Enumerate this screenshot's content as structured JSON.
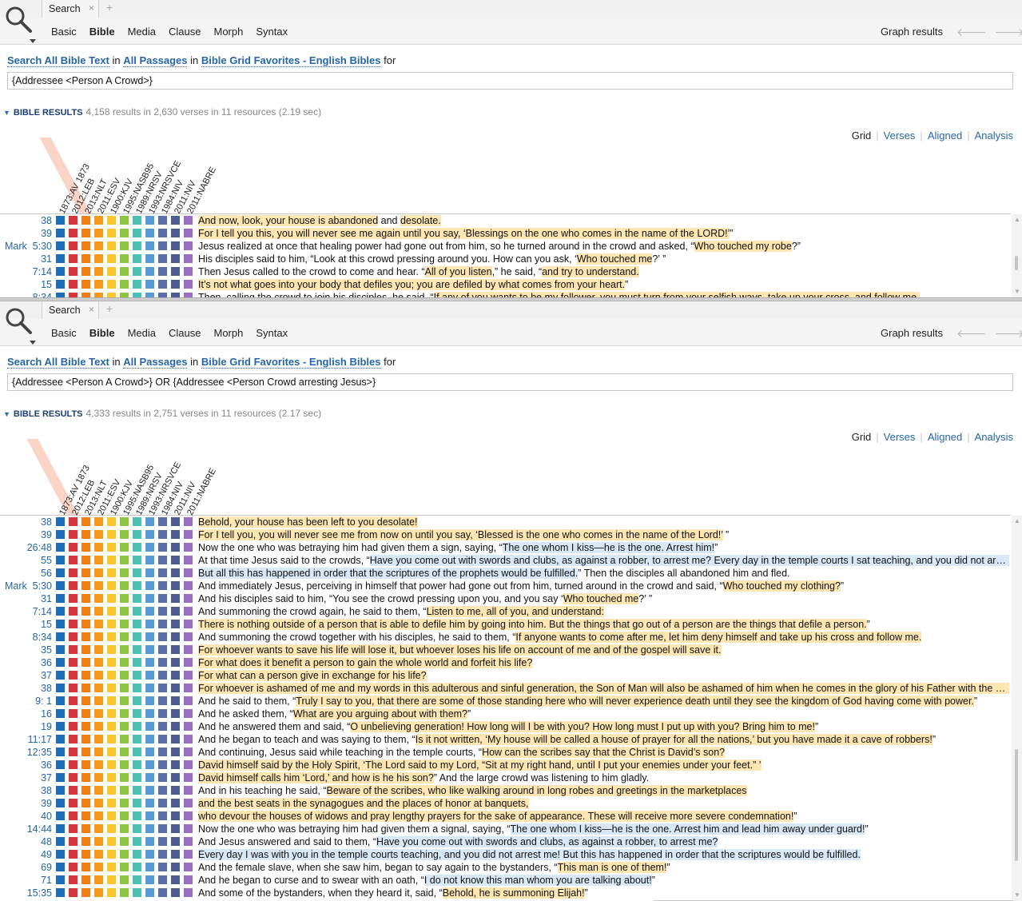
{
  "colors": {
    "squares": [
      "#1f6fb8",
      "#d6353a",
      "#ef7d1a",
      "#f49a1e",
      "#f7c92f",
      "#8cc63e",
      "#4ec1b7",
      "#5a9ad9",
      "#5a6fa8",
      "#4b5e8f",
      "#9b6fc0"
    ]
  },
  "panels": [
    {
      "tab": {
        "label": "Search",
        "close": "×",
        "add": "+"
      },
      "nav": {
        "basic": "Basic",
        "bible": "Bible",
        "media": "Media",
        "clause": "Clause",
        "morph": "Morph",
        "syntax": "Syntax"
      },
      "graph_results": "Graph results",
      "scope": {
        "search_all": "Search All Bible Text",
        "in1": "in",
        "passages": "All Passages",
        "in2": "in",
        "collection": "Bible Grid Favorites - English Bibles",
        "for": "for"
      },
      "query": "{Addressee  <Person A Crowd>}",
      "results_header": {
        "title": "BIBLE RESULTS",
        "stats": "4,158 results in 2,630 verses in 11 resources (2.19 sec)"
      },
      "views": {
        "grid": "Grid",
        "verses": "Verses",
        "aligned": "Aligned",
        "analysis": "Analysis"
      },
      "columns": [
        "1873:AV 1873",
        "2012:LEB",
        "2013:NLT",
        "2011:ESV",
        "1900:KJV",
        "1995:NASB95",
        "1989:NRSV",
        "1993:NRSVCE",
        "1984:NIV",
        "2011:NIV",
        "2011:NABRE"
      ],
      "highlight_col": 2,
      "rows": [
        {
          "book": "",
          "ref": "38",
          "parts": [
            {
              "t": "And now, look, your house is abandoned",
              "h": "y"
            },
            {
              "t": " and ",
              "h": ""
            },
            {
              "t": "desolate.",
              "h": "y"
            }
          ]
        },
        {
          "book": "",
          "ref": "39",
          "parts": [
            {
              "t": "For I tell you this, you will never see me again until you say, ‘Blessings on the one who comes in the name of the LORD!’",
              "h": "y"
            },
            {
              "t": "”",
              "h": ""
            }
          ]
        },
        {
          "book": "Mark",
          "ref": "5:30",
          "parts": [
            {
              "t": "Jesus realized at once that healing power had gone out from him, so he turned around in the crowd and asked, “",
              "h": ""
            },
            {
              "t": "Who touched my robe",
              "h": "y"
            },
            {
              "t": "?”",
              "h": ""
            }
          ]
        },
        {
          "book": "",
          "ref": "31",
          "parts": [
            {
              "t": "His disciples said to him, “Look at this crowd pressing around you. How can you ask, ‘",
              "h": ""
            },
            {
              "t": "Who touched me",
              "h": "y"
            },
            {
              "t": "?’ ”",
              "h": ""
            }
          ]
        },
        {
          "book": "",
          "ref": "7:14",
          "parts": [
            {
              "t": "Then Jesus called to the crowd to come and hear. “",
              "h": ""
            },
            {
              "t": "All of you listen",
              "h": "y"
            },
            {
              "t": ",” he said, “",
              "h": ""
            },
            {
              "t": "and try to understand.",
              "h": "y"
            }
          ]
        },
        {
          "book": "",
          "ref": "15",
          "parts": [
            {
              "t": "It’s not what goes into your body that defiles you; you are defiled by what comes from your heart.",
              "h": "y"
            },
            {
              "t": "”",
              "h": ""
            }
          ]
        },
        {
          "book": "",
          "ref": "8:34",
          "parts": [
            {
              "t": "Then, calling the crowd to join his disciples, he said, “",
              "h": ""
            },
            {
              "t": "If any of you wants to be my follower, you must turn from your selfish ways, take up your cross, and follow me.",
              "h": "y"
            }
          ]
        }
      ]
    },
    {
      "tab": {
        "label": "Search",
        "close": "×",
        "add": "+"
      },
      "nav": {
        "basic": "Basic",
        "bible": "Bible",
        "media": "Media",
        "clause": "Clause",
        "morph": "Morph",
        "syntax": "Syntax"
      },
      "graph_results": "Graph results",
      "scope": {
        "search_all": "Search All Bible Text",
        "in1": "in",
        "passages": "All Passages",
        "in2": "in",
        "collection": "Bible Grid Favorites - English Bibles",
        "for": "for"
      },
      "query": "{Addressee  <Person A Crowd>} OR {Addressee  <Person Crowd arresting Jesus>}",
      "results_header": {
        "title": "BIBLE RESULTS",
        "stats": "4,333 results in 2,751 verses in 11 resources (2.17 sec)"
      },
      "views": {
        "grid": "Grid",
        "verses": "Verses",
        "aligned": "Aligned",
        "analysis": "Analysis"
      },
      "columns": [
        "1873:AV 1873",
        "2012:LEB",
        "2013:NLT",
        "2011:ESV",
        "1900:KJV",
        "1995:NASB95",
        "1989:NRSV",
        "1993:NRSVCE",
        "1984:NIV",
        "2011:NIV",
        "2011:NABRE"
      ],
      "highlight_col": 1,
      "rows": [
        {
          "book": "",
          "ref": "38",
          "parts": [
            {
              "t": "Behold, your house has been left to you desolate!",
              "h": "y"
            }
          ]
        },
        {
          "book": "",
          "ref": "39",
          "parts": [
            {
              "t": "For I tell you, you will never see me from now on until you say, ‘Blessed is the one who comes in the name of the Lord!’",
              "h": "y"
            },
            {
              "t": " ”",
              "h": ""
            }
          ]
        },
        {
          "book": "",
          "ref": "26:48",
          "parts": [
            {
              "t": "Now the one who was betraying him had given them a sign, saying, “",
              "h": ""
            },
            {
              "t": "The one whom I kiss—he is the one. Arrest him!",
              "h": "b"
            },
            {
              "t": "”",
              "h": ""
            }
          ]
        },
        {
          "book": "",
          "ref": "55",
          "parts": [
            {
              "t": "At that time Jesus said to the crowds, “",
              "h": ""
            },
            {
              "t": "Have you come out with swords and clubs, as against a robber, to arrest me? Every day in the temple courts I sat teaching, and you did not arrest me!",
              "h": "b"
            }
          ]
        },
        {
          "book": "",
          "ref": "56",
          "parts": [
            {
              "t": "But all this has happened in order that the scriptures of the prophets would be fulfilled.",
              "h": "b"
            },
            {
              "t": "” Then the disciples all abandoned him and fled.",
              "h": ""
            }
          ]
        },
        {
          "book": "Mark",
          "ref": "5:30",
          "parts": [
            {
              "t": "And immediately Jesus, perceiving in himself that power had gone out from him, turned around in the crowd and said, “",
              "h": ""
            },
            {
              "t": "Who touched my clothing?",
              "h": "y"
            },
            {
              "t": "”",
              "h": ""
            }
          ]
        },
        {
          "book": "",
          "ref": "31",
          "parts": [
            {
              "t": "And his disciples said to him, “You see the crowd pressing upon you, and you say ‘",
              "h": ""
            },
            {
              "t": "Who touched me",
              "h": "y"
            },
            {
              "t": "?’ ”",
              "h": ""
            }
          ]
        },
        {
          "book": "",
          "ref": "7:14",
          "parts": [
            {
              "t": "And summoning the crowd again, he said to them, “",
              "h": ""
            },
            {
              "t": "Listen to me, all of you, and understand:",
              "h": "y"
            }
          ]
        },
        {
          "book": "",
          "ref": "15",
          "parts": [
            {
              "t": "There is nothing outside of a person that is able to defile him by going into him. But the things that go out of a person are the things that defile a person.",
              "h": "y"
            },
            {
              "t": "”",
              "h": ""
            }
          ]
        },
        {
          "book": "",
          "ref": "8:34",
          "parts": [
            {
              "t": "And summoning the crowd together with his disciples, he said to them, “",
              "h": ""
            },
            {
              "t": "If anyone wants to come after me, let him deny himself and take up his cross and follow me.",
              "h": "y"
            }
          ]
        },
        {
          "book": "",
          "ref": "35",
          "parts": [
            {
              "t": "For whoever wants to save his life will lose it, but whoever loses his life on account of me and of the gospel will save it.",
              "h": "y"
            }
          ]
        },
        {
          "book": "",
          "ref": "36",
          "parts": [
            {
              "t": "For what does it benefit a person to gain the whole world and forfeit his life?",
              "h": "y"
            }
          ]
        },
        {
          "book": "",
          "ref": "37",
          "parts": [
            {
              "t": "For what can a person give in exchange for his life?",
              "h": "y"
            }
          ]
        },
        {
          "book": "",
          "ref": "38",
          "parts": [
            {
              "t": "For whoever is ashamed of me and my words in this adulterous and sinful generation, the Son of Man will also be ashamed of him when he comes in the glory of his Father with the holy angels.",
              "h": "y"
            }
          ]
        },
        {
          "book": "",
          "ref": "9:  1",
          "parts": [
            {
              "t": "And he said to them, “",
              "h": ""
            },
            {
              "t": "Truly I say to you, that there are some of those standing here who will never experience death until they see the kingdom of God having come with power.",
              "h": "y"
            },
            {
              "t": "”",
              "h": ""
            }
          ]
        },
        {
          "book": "",
          "ref": "16",
          "parts": [
            {
              "t": "And he asked them, “",
              "h": ""
            },
            {
              "t": "What are you arguing about with them?",
              "h": "y"
            },
            {
              "t": "”",
              "h": ""
            }
          ]
        },
        {
          "book": "",
          "ref": "19",
          "parts": [
            {
              "t": "And he answered them and said, “",
              "h": ""
            },
            {
              "t": "O unbelieving generation! How long will I be with you? How long must I put up with you? Bring him to me!",
              "h": "y"
            },
            {
              "t": "”",
              "h": ""
            }
          ]
        },
        {
          "book": "",
          "ref": "11:17",
          "parts": [
            {
              "t": "And he began to teach and was saying to them, “",
              "h": ""
            },
            {
              "t": "Is it not written, ‘My house will be called a house of prayer for all the nations,’ but you have made it a cave of robbers!",
              "h": "y"
            },
            {
              "t": "”",
              "h": ""
            }
          ]
        },
        {
          "book": "",
          "ref": "12:35",
          "parts": [
            {
              "t": "And continuing, Jesus said while teaching in the temple courts, “",
              "h": ""
            },
            {
              "t": "How can the scribes say that the Christ is David’s son?",
              "h": "y"
            }
          ]
        },
        {
          "book": "",
          "ref": "36",
          "parts": [
            {
              "t": "David himself said by the Holy Spirit, ‘The Lord said to my Lord, “Sit at my right hand, until I put your enemies under your feet.” ’",
              "h": "y"
            }
          ]
        },
        {
          "book": "",
          "ref": "37",
          "parts": [
            {
              "t": "David himself calls him ‘Lord,’ and how is he his son?",
              "h": "y"
            },
            {
              "t": "” And the large crowd was listening to him gladly.",
              "h": ""
            }
          ]
        },
        {
          "book": "",
          "ref": "38",
          "parts": [
            {
              "t": "And in his teaching he said, “",
              "h": ""
            },
            {
              "t": "Beware of the scribes, who like walking around in long robes and greetings in the marketplaces",
              "h": "y"
            }
          ]
        },
        {
          "book": "",
          "ref": "39",
          "parts": [
            {
              "t": "and the best seats in the synagogues and the places of honor at banquets,",
              "h": "y"
            }
          ]
        },
        {
          "book": "",
          "ref": "40",
          "parts": [
            {
              "t": "who devour the houses of widows and pray lengthy prayers for the sake of appearance. These will receive more severe condemnation!",
              "h": "y"
            },
            {
              "t": "”",
              "h": ""
            }
          ]
        },
        {
          "book": "",
          "ref": "14:44",
          "parts": [
            {
              "t": "Now the one who was betraying him had given them a signal, saying, “",
              "h": ""
            },
            {
              "t": "The one whom I kiss—he is the one. Arrest him and lead him away under guard!",
              "h": "b"
            },
            {
              "t": "”",
              "h": ""
            }
          ]
        },
        {
          "book": "",
          "ref": "48",
          "parts": [
            {
              "t": "And Jesus answered and said to them, “",
              "h": ""
            },
            {
              "t": "Have you come out with swords and clubs, as against a robber, to arrest me?",
              "h": "b"
            }
          ]
        },
        {
          "book": "",
          "ref": "49",
          "parts": [
            {
              "t": "Every day I was with you in the temple courts teaching, and you did not arrest me! But this has happened in order that the scriptures would be fulfilled.",
              "h": "b"
            }
          ]
        },
        {
          "book": "",
          "ref": "69",
          "parts": [
            {
              "t": "And the female slave, when she saw him, began to say again to the bystanders, “",
              "h": ""
            },
            {
              "t": "This man is one of them!",
              "h": "y"
            },
            {
              "t": "”",
              "h": ""
            }
          ]
        },
        {
          "book": "",
          "ref": "71",
          "parts": [
            {
              "t": "And he began to curse and to swear with an oath, “",
              "h": ""
            },
            {
              "t": "I do not know this man whom you are talking about!",
              "h": "b"
            },
            {
              "t": "”",
              "h": ""
            }
          ]
        },
        {
          "book": "",
          "ref": "15:35",
          "parts": [
            {
              "t": "And some of the bystanders, when they heard it, said, “",
              "h": ""
            },
            {
              "t": "Behold, he is summoning Elijah!",
              "h": "y"
            },
            {
              "t": "”",
              "h": ""
            }
          ]
        }
      ]
    }
  ]
}
